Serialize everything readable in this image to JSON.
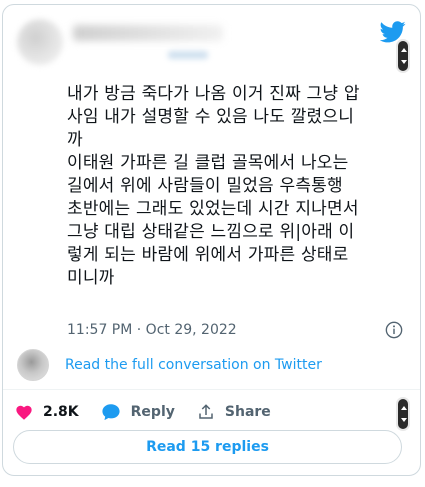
{
  "tweet": {
    "text": "내가 방금 죽다가 나옴 이거 진짜 그냥 압\n사임 내가 설명할 수 있음 나도 깔렸으니\n까\n이태원 가파른 길 클럽 골목에서 나오는\n길에서 위에 사람들이 밀었음 우측통행\n초반에는 그래도 있었는데 시간 지나면서\n그냥 대립 상태같은 느낌으로 위|아래 이\n렇게 되는 바람에 위에서 가파른 상태로\n미니까",
    "timestamp": "11:57 PM · Oct 29, 2022"
  },
  "conversation": {
    "link_label": "Read the full conversation on Twitter"
  },
  "actions": {
    "likes": "2.8K",
    "reply_label": "Reply",
    "share_label": "Share"
  },
  "read_replies_label": "Read 15 replies",
  "colors": {
    "twitter_blue": "#1d9bf0",
    "like_red": "#f91880",
    "muted": "#536471",
    "border": "#cfd9de"
  },
  "icons": [
    "twitter-bird-icon",
    "info-icon",
    "heart-icon",
    "reply-bubble-icon",
    "share-icon",
    "scroll-handle-icon"
  ]
}
